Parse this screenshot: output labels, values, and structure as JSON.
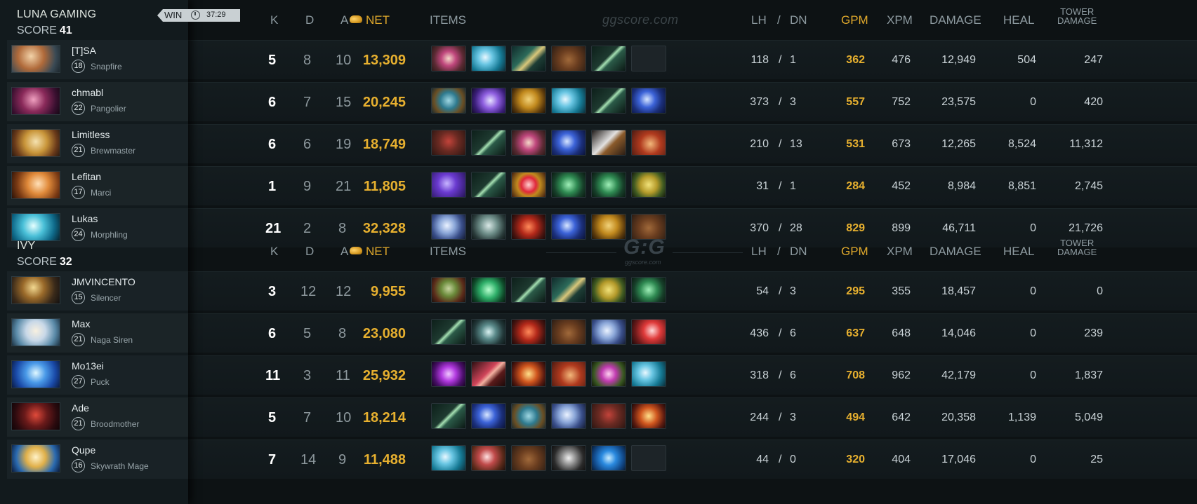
{
  "match": {
    "teams": [
      {
        "name": "LUNA GAMING",
        "score_label": "SCORE",
        "score": "41",
        "result": "WIN",
        "duration": "37:29",
        "players": [
          {
            "name": "[T]SA",
            "level": "18",
            "hero": "Snapfire",
            "k": "5",
            "d": "8",
            "a": "10",
            "net": "13,309",
            "lh": "118",
            "dn": "1",
            "gpm": "362",
            "xpm": "476",
            "damage": "12,949",
            "heal": "504",
            "tower": "247",
            "items": [
              "octarine-core",
              "ethereal-blade",
              "mystic-staff",
              "boots",
              "staff-of-wizardry",
              "empty"
            ]
          },
          {
            "name": "chmabl",
            "level": "22",
            "hero": "Pangolier",
            "k": "6",
            "d": "7",
            "a": "15",
            "net": "20,245",
            "lh": "373",
            "dn": "3",
            "gpm": "557",
            "xpm": "752",
            "damage": "23,575",
            "heal": "0",
            "tower": "420",
            "items": [
              "arcane-boots",
              "diffusal-blade",
              "helm",
              "ethereal-blade",
              "staff-of-wizardry",
              "aghanims-scepter"
            ]
          },
          {
            "name": "Limitless",
            "level": "21",
            "hero": "Brewmaster",
            "k": "6",
            "d": "6",
            "a": "19",
            "net": "18,749",
            "lh": "210",
            "dn": "13",
            "gpm": "531",
            "xpm": "673",
            "damage": "12,265",
            "heal": "8,524",
            "tower": "11,312",
            "items": [
              "helm-of-dominator",
              "staff-of-wizardry",
              "octarine-core",
              "aghanims-scepter",
              "battle-axe",
              "cloak"
            ]
          },
          {
            "name": "Lefitan",
            "level": "17",
            "hero": "Marci",
            "k": "1",
            "d": "9",
            "a": "21",
            "net": "11,805",
            "lh": "31",
            "dn": "1",
            "gpm": "284",
            "xpm": "452",
            "damage": "8,984",
            "heal": "8,851",
            "tower": "2,745",
            "items": [
              "mage-hat",
              "staff-of-wizardry",
              "orb",
              "pipe",
              "pipe",
              "mask"
            ]
          },
          {
            "name": "Lukas",
            "level": "24",
            "hero": "Morphling",
            "k": "21",
            "d": "2",
            "a": "8",
            "net": "32,328",
            "lh": "370",
            "dn": "28",
            "gpm": "829",
            "xpm": "899",
            "damage": "46,711",
            "heal": "0",
            "tower": "21,726",
            "items": [
              "manta",
              "eagle",
              "satanic",
              "aghanims-scepter",
              "helm",
              "boots"
            ]
          }
        ]
      },
      {
        "name": "IVY",
        "score_label": "SCORE",
        "score": "32",
        "players": [
          {
            "name": "JMVINCENTO",
            "level": "15",
            "hero": "Silencer",
            "k": "3",
            "d": "12",
            "a": "12",
            "net": "9,955",
            "lh": "54",
            "dn": "3",
            "gpm": "295",
            "xpm": "355",
            "damage": "18,457",
            "heal": "0",
            "tower": "0",
            "items": [
              "bowl",
              "cloak-green",
              "staff-of-wizardry",
              "mystic-staff",
              "mask",
              "pipe"
            ]
          },
          {
            "name": "Max",
            "level": "21",
            "hero": "Naga Siren",
            "k": "6",
            "d": "5",
            "a": "8",
            "net": "23,080",
            "lh": "436",
            "dn": "6",
            "gpm": "637",
            "xpm": "648",
            "damage": "14,046",
            "heal": "0",
            "tower": "239",
            "items": [
              "staff-of-wizardry",
              "skull",
              "satanic",
              "boots",
              "manta",
              "heart"
            ]
          },
          {
            "name": "Mo13ei",
            "level": "27",
            "hero": "Puck",
            "k": "11",
            "d": "3",
            "a": "11",
            "net": "25,932",
            "lh": "318",
            "dn": "6",
            "gpm": "708",
            "xpm": "962",
            "damage": "42,179",
            "heal": "0",
            "tower": "1,837",
            "items": [
              "dagon",
              "dagger",
              "wand",
              "cloak",
              "orb-purple",
              "ethereal-blade"
            ]
          },
          {
            "name": "Ade",
            "level": "21",
            "hero": "Broodmother",
            "k": "5",
            "d": "7",
            "a": "10",
            "net": "18,214",
            "lh": "244",
            "dn": "3",
            "gpm": "494",
            "xpm": "642",
            "damage": "20,358",
            "heal": "1,139",
            "tower": "5,049",
            "items": [
              "staff-of-wizardry",
              "aghanims-scepter",
              "arcane-boots",
              "manta",
              "helm-of-dominator",
              "wand"
            ]
          },
          {
            "name": "Qupe",
            "level": "16",
            "hero": "Skywrath Mage",
            "k": "7",
            "d": "14",
            "a": "9",
            "net": "11,488",
            "lh": "44",
            "dn": "0",
            "gpm": "320",
            "xpm": "404",
            "damage": "17,046",
            "heal": "0",
            "tower": "25",
            "items": [
              "ethereal-blade",
              "dagger-red",
              "boots",
              "hook",
              "eagle-blue",
              "empty"
            ]
          }
        ]
      }
    ]
  },
  "columns": {
    "k": "K",
    "d": "D",
    "a": "A",
    "net": "NET",
    "items": "ITEMS",
    "lh": "LH",
    "slash": "/",
    "dn": "DN",
    "gpm": "GPM",
    "xpm": "XPM",
    "damage": "DAMAGE",
    "heal": "HEAL",
    "tower_1": "TOWER",
    "tower_2": "DAMAGE"
  },
  "watermark": {
    "site": "ggscore.com",
    "logo": "G:G"
  },
  "colors": {
    "gold": "#e7b02f",
    "background": "#0d1214",
    "panel": "#121a1d"
  }
}
